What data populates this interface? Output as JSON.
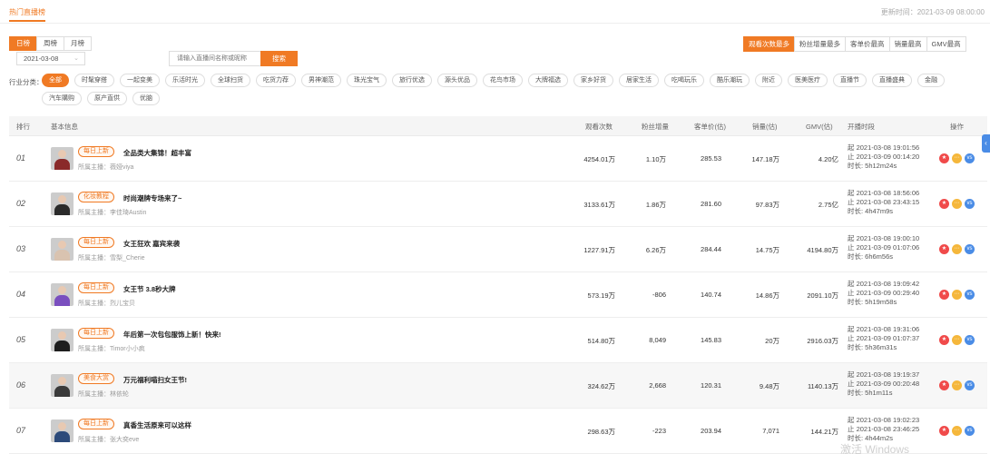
{
  "header": {
    "title": "热门直播榜",
    "update_time": "更新时间：2021-03-09 08:00:00"
  },
  "period_tabs": [
    "日榜",
    "周榜",
    "月榜"
  ],
  "date": "2021-03-08",
  "search": {
    "placeholder": "请输入直播间名称或昵称",
    "button": "搜索"
  },
  "rank_tabs": [
    "观看次数最多",
    "粉丝增量最多",
    "客单价最高",
    "销量最高",
    "GMV最高"
  ],
  "industry": {
    "label": "行业分类：",
    "row1": [
      "全部",
      "时髦穿搭",
      "一起变美",
      "乐活时光",
      "全球扫货",
      "吃货力荐",
      "男神潮范",
      "珠光宝气",
      "旅行优选",
      "源头优品",
      "花鸟市场",
      "大牌福选",
      "家乡好货",
      "居家生活",
      "吃喝玩乐",
      "酷乐潮玩",
      "附近",
      "医美医疗",
      "直播节",
      "直播盛典",
      "金融"
    ],
    "row2": [
      "汽车購购",
      "原产直供",
      "优脑"
    ]
  },
  "table": {
    "headers": {
      "rank": "排行",
      "info": "基本信息",
      "views": "观看次数",
      "fans": "粉丝增量",
      "price": "客单价(估)",
      "sales": "销量(估)",
      "gmv": "GMV(估)",
      "time": "开播时段",
      "ops": "操作"
    },
    "anchor_prefix": "所属主播：",
    "rows": [
      {
        "rank": "01",
        "badge": "每日上新",
        "title": "全品类大集锦！超丰富",
        "anchor": "薇娅viya",
        "views": "4254.01万",
        "fans": "1.10万",
        "price": "285.53",
        "sales": "147.18万",
        "gmv": "4.20亿",
        "start": "起 2021-03-08 19:01:56",
        "end": "止 2021-03-09 00:14:20",
        "duration": "时长: 5h12m24s",
        "avatar_color": "#8a2a2a"
      },
      {
        "rank": "02",
        "badge": "化妆教程",
        "title": "时尚潮牌专场来了~",
        "anchor": "李佳琦Austin",
        "views": "3133.61万",
        "fans": "1.86万",
        "price": "281.60",
        "sales": "97.83万",
        "gmv": "2.75亿",
        "start": "起 2021-03-08 18:56:06",
        "end": "止 2021-03-08 23:43:15",
        "duration": "时长: 4h47m9s",
        "avatar_color": "#2b2b2b"
      },
      {
        "rank": "03",
        "badge": "每日上新",
        "title": "女王狂欢 嘉宾来袭",
        "anchor": "雪梨_Cherie",
        "views": "1227.91万",
        "fans": "6.26万",
        "price": "284.44",
        "sales": "14.75万",
        "gmv": "4194.80万",
        "start": "起 2021-03-08 19:00:10",
        "end": "止 2021-03-09 01:07:06",
        "duration": "时长: 6h6m56s",
        "avatar_color": "#d9c3b0"
      },
      {
        "rank": "04",
        "badge": "每日上新",
        "title": "女王节 3.8秒大牌",
        "anchor": "烈儿宝贝",
        "views": "573.19万",
        "fans": "-806",
        "price": "140.74",
        "sales": "14.86万",
        "gmv": "2091.10万",
        "start": "起 2021-03-08 19:09:42",
        "end": "止 2021-03-09 00:29:40",
        "duration": "时长: 5h19m58s",
        "avatar_color": "#7a4fbf"
      },
      {
        "rank": "05",
        "badge": "每日上新",
        "title": "年后第一次包包服饰上新！快来!",
        "anchor": "Timor小小疯",
        "views": "514.80万",
        "fans": "8,049",
        "price": "145.83",
        "sales": "20万",
        "gmv": "2916.03万",
        "start": "起 2021-03-08 19:31:06",
        "end": "止 2021-03-09 01:07:37",
        "duration": "时长: 5h36m31s",
        "avatar_color": "#1e1e1e"
      },
      {
        "rank": "06",
        "badge": "美食大赏",
        "title": "万元福利喵扫女王节!",
        "anchor": "林依轮",
        "views": "324.62万",
        "fans": "2,668",
        "price": "120.31",
        "sales": "9.48万",
        "gmv": "1140.13万",
        "start": "起 2021-03-08 19:19:37",
        "end": "止 2021-03-09 00:20:48",
        "duration": "时长: 5h1m11s",
        "avatar_color": "#3a3a3a"
      },
      {
        "rank": "07",
        "badge": "每日上新",
        "title": "真香生活原来可以这样",
        "anchor": "张大奕eve",
        "views": "298.63万",
        "fans": "-223",
        "price": "203.94",
        "sales": "7,071",
        "gmv": "144.21万",
        "start": "起 2021-03-08 19:02:23",
        "end": "止 2021-03-08 23:46:25",
        "duration": "时长: 4h44m2s",
        "avatar_color": "#2c4a7a"
      }
    ]
  },
  "watermark": "激活 Windows",
  "colors": {
    "accent": "#f07a24",
    "star": "#f04a4a",
    "more": "#f5b73b",
    "vs": "#4a8ce6"
  }
}
